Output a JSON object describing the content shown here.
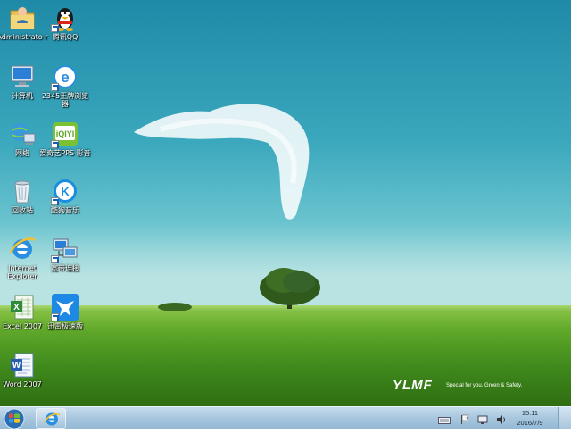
{
  "desktop": {
    "icons": [
      {
        "name": "Administrator",
        "label": "Administrato r",
        "icon": "user-folder-icon"
      },
      {
        "name": "qq",
        "label": "腾讯QQ",
        "icon": "qq-penguin-icon"
      },
      {
        "name": "computer",
        "label": "计算机",
        "icon": "computer-icon"
      },
      {
        "name": "2345-browser",
        "label": "2345王牌浏览器",
        "icon": "2345-browser-icon"
      },
      {
        "name": "network",
        "label": "网络",
        "icon": "network-icon"
      },
      {
        "name": "iqiyi",
        "label": "爱奇艺PPS 影音",
        "icon": "iqiyi-icon"
      },
      {
        "name": "recycle-bin",
        "label": "回收站",
        "icon": "recycle-bin-icon"
      },
      {
        "name": "kugou",
        "label": "酷狗音乐",
        "icon": "kugou-icon"
      },
      {
        "name": "ie",
        "label": "Internet Explorer",
        "icon": "internet-explorer-icon"
      },
      {
        "name": "remote-desktop",
        "label": "宽带连接",
        "icon": "remote-desktop-icon"
      },
      {
        "name": "excel",
        "label": "Excel 2007",
        "icon": "excel-icon"
      },
      {
        "name": "xunlei",
        "label": "迅雷极速版",
        "icon": "xunlei-icon"
      },
      {
        "name": "word",
        "label": "Word 2007",
        "icon": "word-icon"
      }
    ],
    "watermark": {
      "logo": "YLMF",
      "slogan": "Special for you, Green & Safety."
    }
  },
  "taskbar": {
    "start_icon": "windows-start-icon",
    "pinned": [
      {
        "name": "internet-explorer",
        "icon": "internet-explorer-icon"
      }
    ],
    "tray_icons": [
      "keyboard-icon",
      "flag-icon",
      "network-tray-icon",
      "volume-icon"
    ],
    "clock": {
      "time": "15:11",
      "date": "2016/7/9"
    }
  },
  "colors": {
    "sky_top": "#1f8aa7",
    "grass": "#3f8a1c",
    "taskbar": "#a9c8df"
  }
}
